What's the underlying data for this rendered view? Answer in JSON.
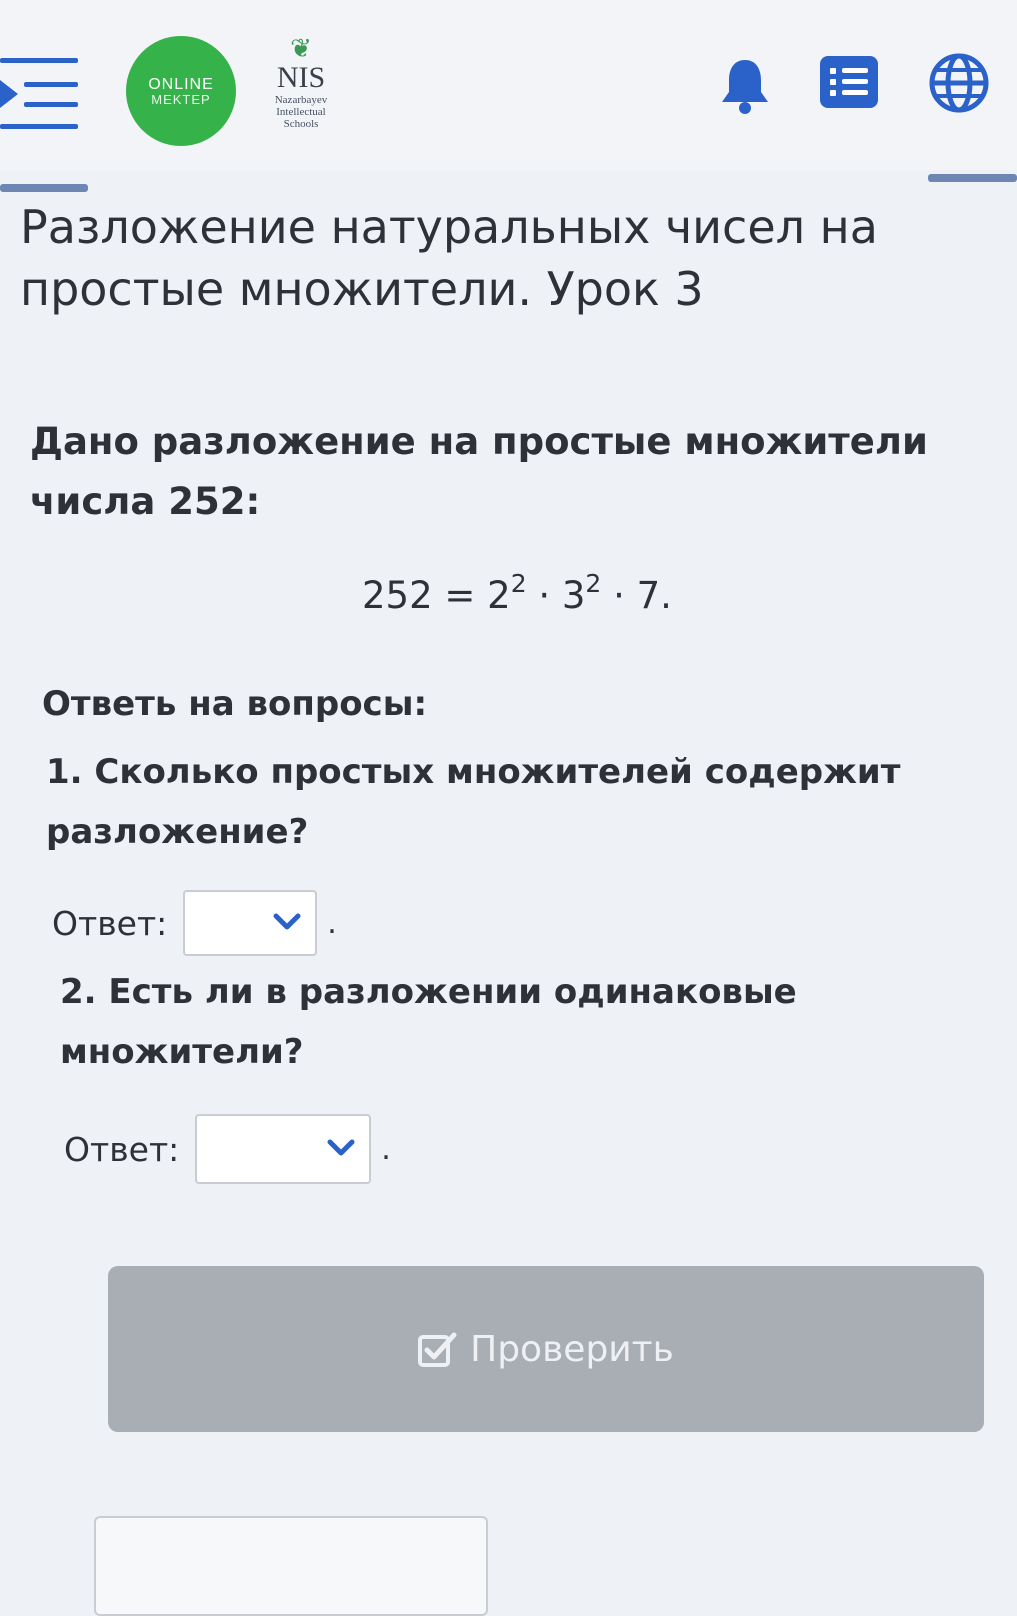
{
  "header": {
    "online_mektep_line1": "ONLINE",
    "online_mektep_line2": "MEKTEP",
    "nis_title": "NIS",
    "nis_line1": "Nazarbayev",
    "nis_line2": "Intellectual",
    "nis_line3": "Schools",
    "icons": [
      "menu-icon",
      "bell-icon",
      "list-icon",
      "globe-icon"
    ]
  },
  "lesson": {
    "title": "Разложение натуральных чисел на простые множители. Урок 3",
    "intro": "Дано разложение на простые множители числа 252:",
    "formula": {
      "lhs": "252 = 2",
      "exp1": "2",
      "mid": " · 3",
      "exp2": "2",
      "rhs": " · 7."
    },
    "questions_heading": "Ответь на вопросы:",
    "questions": [
      {
        "text": "1. Сколько простых множителей содержит разложение?",
        "answer_label": "Ответ:",
        "selected_value": "",
        "suffix": "."
      },
      {
        "text": "2. Есть ли в разложении одинаковые множители?",
        "answer_label": "Ответ:",
        "selected_value": "",
        "suffix": "."
      }
    ],
    "check_button_label": "Проверить"
  },
  "colors": {
    "accent_blue": "#2b62c9",
    "logo_green": "#35b24a",
    "button_gray": "#a9adb4"
  }
}
